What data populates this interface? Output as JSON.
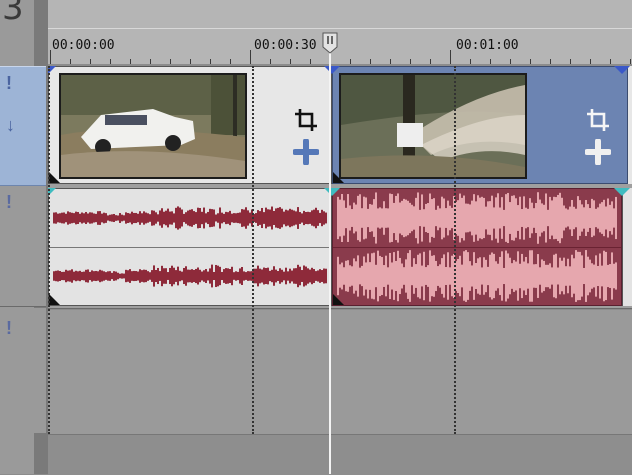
{
  "track_header": {
    "track_number": "3"
  },
  "ruler": {
    "labels": [
      "00:00:00",
      "00:00:30",
      "00:01:00"
    ]
  },
  "clips": {
    "video_1": {
      "icons": [
        "crop-icon",
        "pan-icon"
      ]
    },
    "video_2": {
      "icons": [
        "crop-icon",
        "pan-icon"
      ]
    }
  },
  "colors": {
    "video_clip_selected": "#6c84b2",
    "audio_clip_selected": "#8a3b4c",
    "waveform_unselected": "#8e2a3a",
    "waveform_selected": "#e6a7ae",
    "playhead": "#f4f4f4"
  }
}
